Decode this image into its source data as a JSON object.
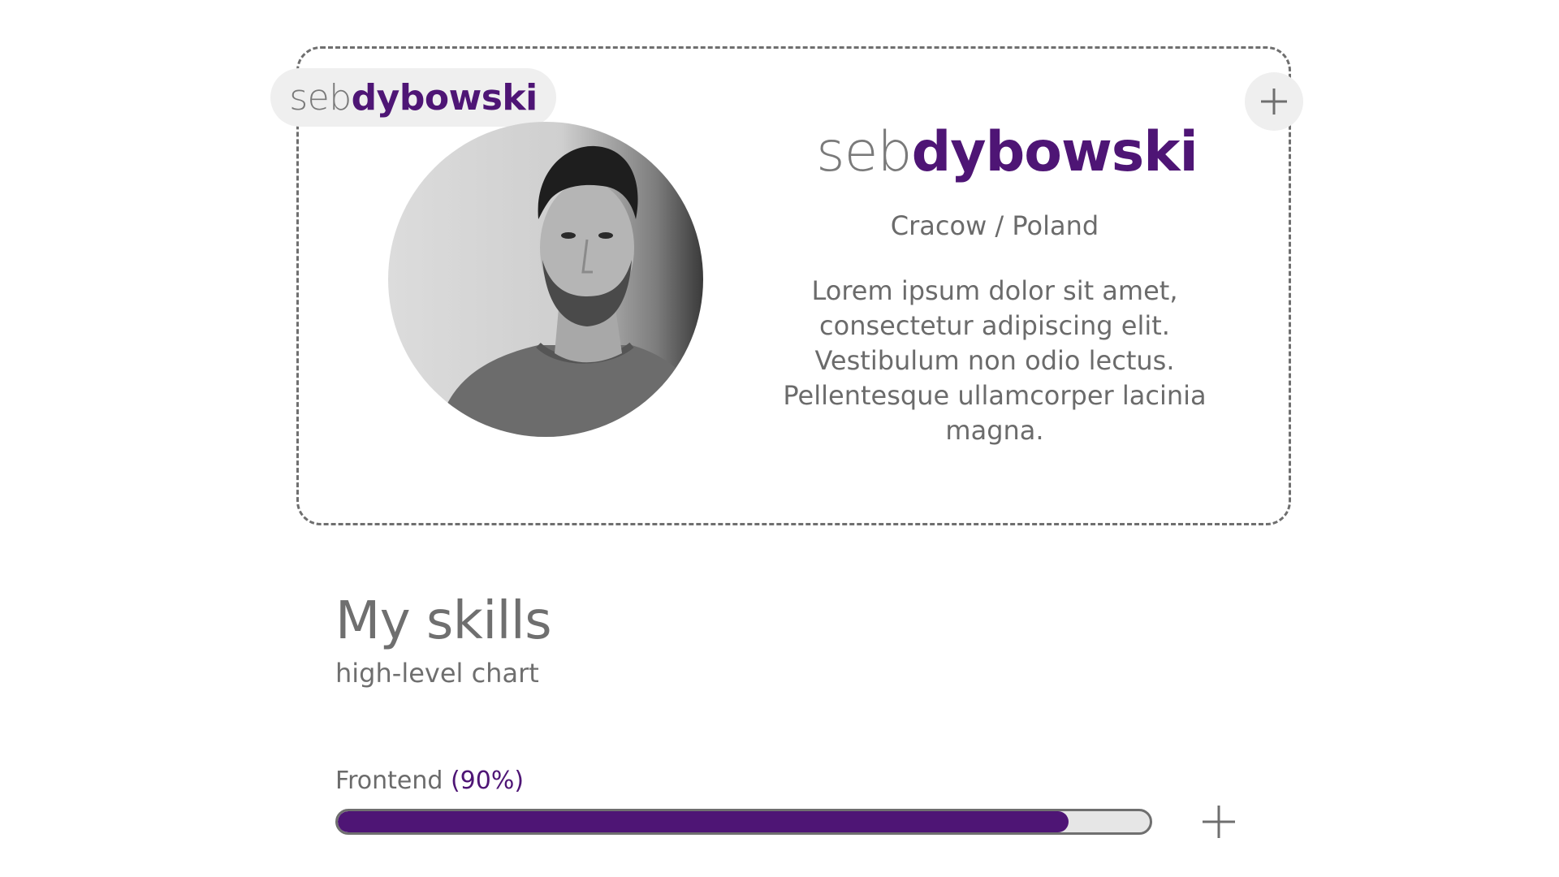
{
  "header": {
    "logo_light": "seb",
    "logo_strong": "dybowski"
  },
  "profile": {
    "name_light": "seb",
    "name_strong": "dybowski",
    "location": "Cracow / Poland",
    "bio": "Lorem ipsum dolor sit amet, consectetur adipiscing elit. Vestibulum non odio lectus. Pellentesque ullamcorper lacinia magna.",
    "expand_icon": "plus-icon"
  },
  "skills": {
    "title": "My skills",
    "subtitle": "high-level chart",
    "items": [
      {
        "label": "Frontend",
        "percent_label": "(90%)",
        "level": 0.9,
        "expand_icon": "plus-icon"
      }
    ]
  },
  "colors": {
    "accent": "#4e1575",
    "text": "#6d6d6d",
    "pill_bg": "#efefef",
    "track_bg": "#e6e6e6"
  }
}
